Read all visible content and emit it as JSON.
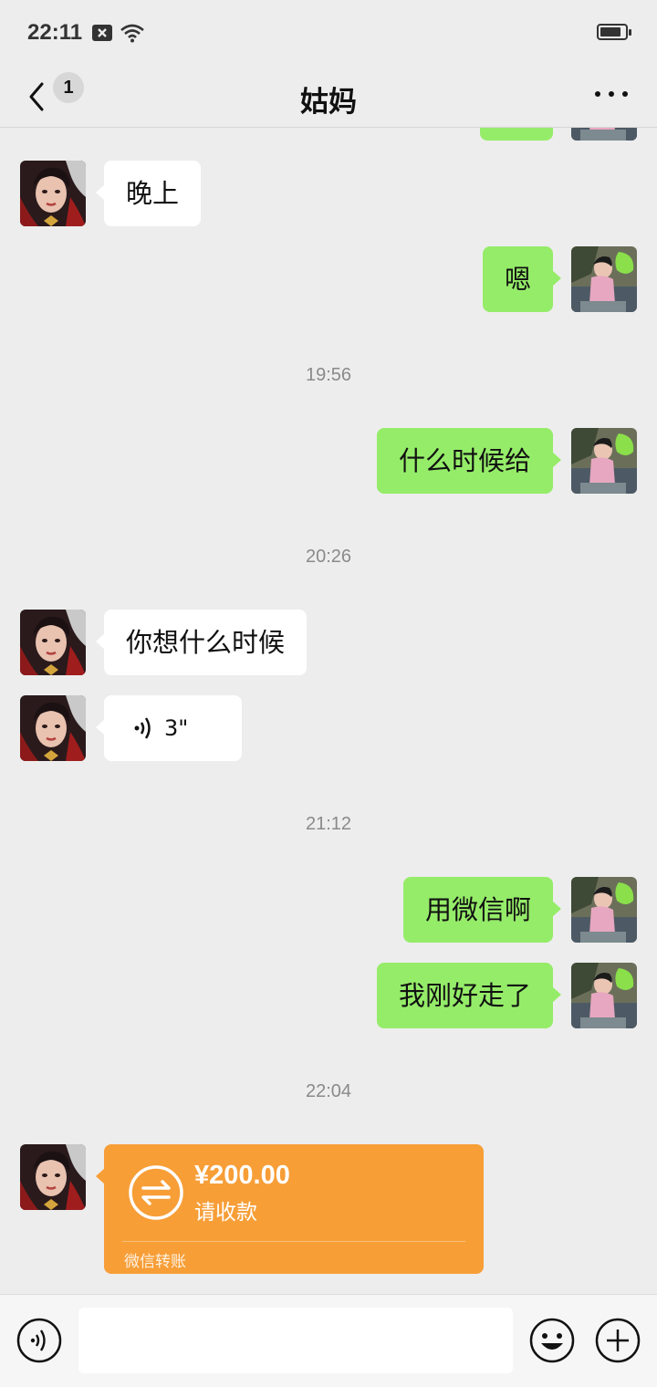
{
  "status": {
    "time": "22:11"
  },
  "header": {
    "back_count": "1",
    "title": "姑妈"
  },
  "messages": {
    "m1": "晚上",
    "m2": "嗯",
    "ts1": "19:56",
    "m3": "什么时候给",
    "ts2": "20:26",
    "m4": "你想什么时候",
    "voice_duration": "3\"",
    "ts3": "21:12",
    "m5": "用微信啊",
    "m6": "我刚好走了",
    "ts4": "22:04"
  },
  "transfer": {
    "amount": "¥200.00",
    "status": "请收款",
    "footer": "微信转账"
  },
  "colors": {
    "green_bubble": "#95ec69",
    "transfer": "#f79e37",
    "background": "#ededed"
  }
}
